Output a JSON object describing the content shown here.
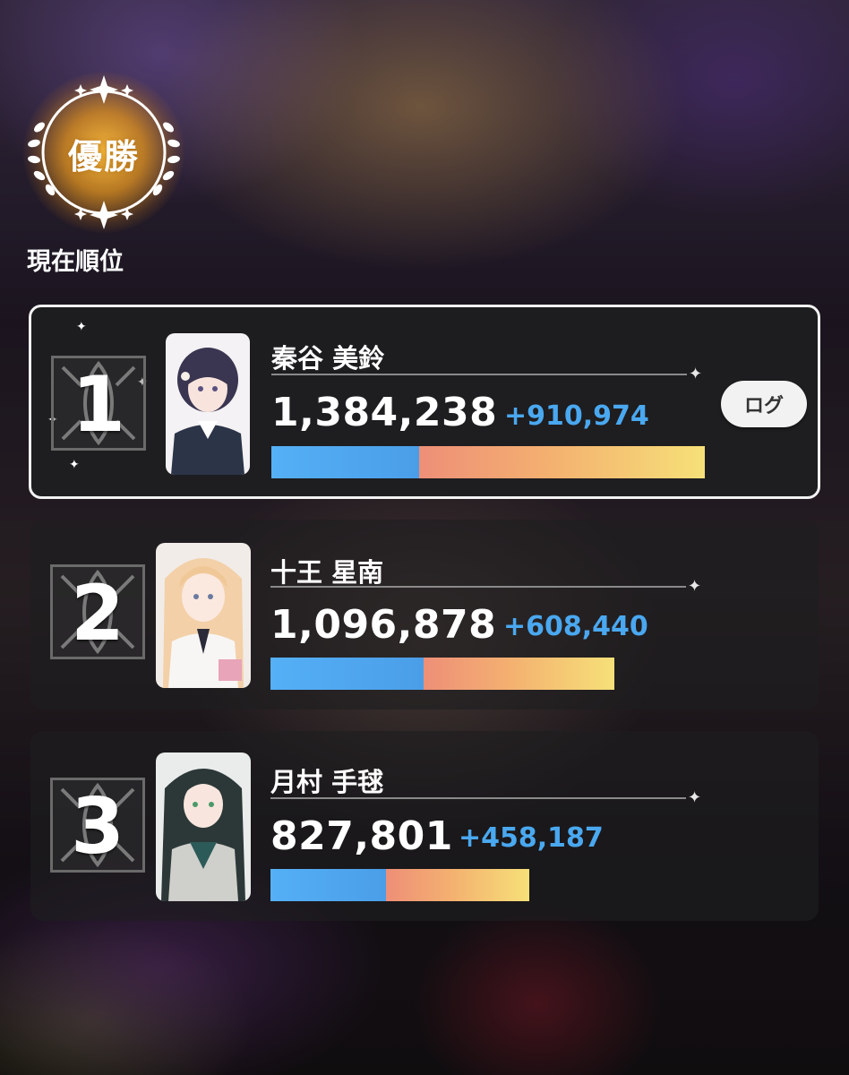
{
  "header": {
    "emblem_text": "優勝",
    "rank_label": "現在順位"
  },
  "ranking": [
    {
      "rank": "1",
      "name": "秦谷 美鈴",
      "score": "1,384,238",
      "delta": "+910,974",
      "score_value": 1384238,
      "delta_value": 910974,
      "action_label": "ログ"
    },
    {
      "rank": "2",
      "name": "十王 星南",
      "score": "1,096,878",
      "delta": "+608,440",
      "score_value": 1096878,
      "delta_value": 608440
    },
    {
      "rank": "3",
      "name": "月村 手毬",
      "score": "827,801",
      "delta": "+458,187",
      "score_value": 827801,
      "delta_value": 458187
    }
  ],
  "colors": {
    "delta_text": "#4aa8f0",
    "bar_base": "#55b0f6",
    "bar_gain_start": "#ee8f78",
    "bar_gain_end": "#f6e078",
    "emblem_glow": "#f0a830"
  }
}
